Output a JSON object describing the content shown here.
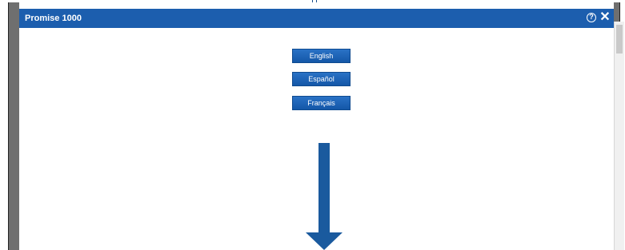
{
  "dialog": {
    "title": "Promise 1000",
    "help_icon": "help-circle-icon",
    "close_icon": "close-icon"
  },
  "language_buttons": [
    {
      "label": "English"
    },
    {
      "label": "Español"
    },
    {
      "label": "Français"
    }
  ],
  "indicator": {
    "icon": "down-arrow-icon",
    "color": "#1a5a9e"
  },
  "colors": {
    "titlebar": "#1c5eae",
    "button": "#1e67bb",
    "frame": "#6f6f6f"
  }
}
